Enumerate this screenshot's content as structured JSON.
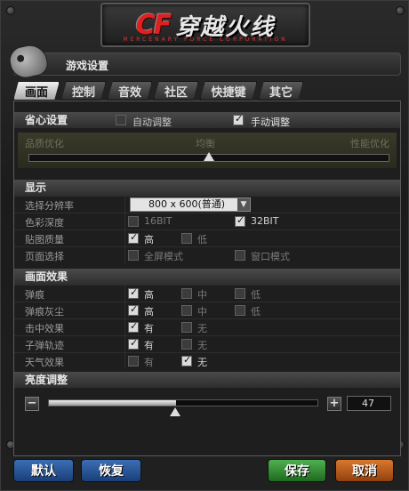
{
  "logo": {
    "cf": "CF",
    "name": "穿越火线",
    "sub": "MERCENARY  FORCE  CORPORATION"
  },
  "window": {
    "title": "游戏设置"
  },
  "tabs": [
    {
      "label": "画面",
      "active": true
    },
    {
      "label": "控制",
      "active": false
    },
    {
      "label": "音效",
      "active": false
    },
    {
      "label": "社区",
      "active": false
    },
    {
      "label": "快捷键",
      "active": false
    },
    {
      "label": "其它",
      "active": false
    }
  ],
  "economy": {
    "header": "省心设置",
    "auto_label": "自动调整",
    "auto_checked": false,
    "manual_label": "手动调整",
    "manual_checked": true,
    "quality_left": "品质优化",
    "quality_mid": "均衡",
    "quality_right": "性能优化",
    "quality_level": 0.5
  },
  "display": {
    "header": "显示",
    "resolution_label": "选择分辨率",
    "resolution_value": "800 x 600(普通)",
    "color_depth_label": "色彩深度",
    "depth_16": "16BIT",
    "depth_32": "32BIT",
    "texture_label": "贴图质量",
    "texture_high": "高",
    "texture_low": "低",
    "page_label": "页面选择",
    "fullscreen": "全屏模式",
    "windowed": "窗口模式"
  },
  "effects": {
    "header": "画面效果",
    "bullet_hole": {
      "label": "弹痕",
      "high": "高",
      "mid": "中",
      "low": "低"
    },
    "bullet_dust": {
      "label": "弹痕灰尘",
      "high": "高",
      "mid": "中",
      "low": "低"
    },
    "hit_effect": {
      "label": "击中效果",
      "yes": "有",
      "no": "无"
    },
    "trail": {
      "label": "子弹轨迹",
      "yes": "有",
      "no": "无"
    },
    "weather": {
      "label": "天气效果",
      "yes": "有",
      "no": "无"
    }
  },
  "brightness": {
    "header": "亮度调整",
    "minus": "−",
    "plus": "+",
    "value": "47",
    "level": 0.47
  },
  "buttons": {
    "default": "默认",
    "restore": "恢复",
    "save": "保存",
    "cancel": "取消"
  }
}
